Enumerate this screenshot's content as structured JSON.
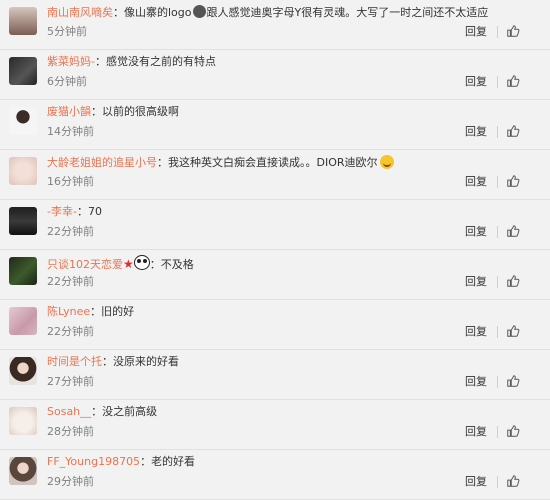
{
  "comments": [
    {
      "user": "南山南风嘀矣",
      "text_before": "像山寨的logo",
      "text_after": "跟人感觉迪奥字母Y很有灵魂。大写了一时之间还不太适应",
      "time": "5分钟前",
      "avatar_icon": "avatar-woman-dark-hair-icon"
    },
    {
      "user": "紫菜妈妈-",
      "text": "感觉没有之前的有特点",
      "time": "6分钟前",
      "avatar_icon": "avatar-dark-photo-icon"
    },
    {
      "user": "废猫小韻",
      "text": "以前的很高级啊",
      "time": "14分钟前",
      "avatar_icon": "avatar-woman-white-top-icon"
    },
    {
      "user": "大龄老姐姐的追星小号",
      "text": "我这种英文白痴会直接读成。。DIOR迪欧尔",
      "time": "16分钟前",
      "avatar_icon": "avatar-light-photo-icon"
    },
    {
      "user": "-李幸-",
      "text": "70",
      "time": "22分钟前",
      "avatar_icon": "avatar-dark-figure-icon"
    },
    {
      "user": "只谈102天恋爱",
      "text": "不及格",
      "time": "22分钟前",
      "avatar_icon": "avatar-green-photo-icon"
    },
    {
      "user": "陈Lynee",
      "text": "旧的好",
      "time": "22分钟前",
      "avatar_icon": "avatar-pink-photo-icon"
    },
    {
      "user": "时间是个托",
      "text": "没原来的好看",
      "time": "27分钟前",
      "avatar_icon": "avatar-girl-long-hair-icon"
    },
    {
      "user": "Sosah__",
      "text": "没之前高级",
      "time": "28分钟前",
      "avatar_icon": "avatar-cat-icon"
    },
    {
      "user": "FF_Young198705",
      "text": "老的好看",
      "time": "29分钟前",
      "avatar_icon": "avatar-woman-portrait-icon"
    }
  ],
  "actions": {
    "reply_label": "回复"
  },
  "colors": {
    "username": "#eb7350",
    "background": "#f2f2f2",
    "time": "#808080"
  },
  "icons": {
    "like": "thumbs-up-icon",
    "logo_badge": "dior-logo-badge-icon",
    "laugh_emoji": "laughing-emoji-icon",
    "star": "star-icon",
    "panda": "panda-icon"
  }
}
